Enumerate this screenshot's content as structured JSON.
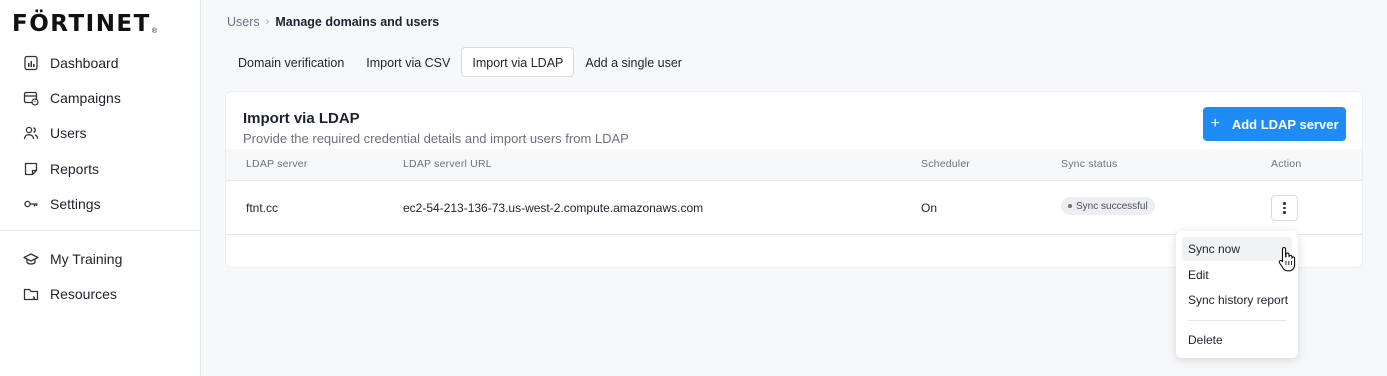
{
  "logo": {
    "text": "FÖRTINET",
    "reg": "®"
  },
  "sidebar": {
    "items": [
      {
        "label": "Dashboard",
        "icon": "dashboard-icon"
      },
      {
        "label": "Campaigns",
        "icon": "campaigns-icon"
      },
      {
        "label": "Users",
        "icon": "users-icon"
      },
      {
        "label": "Reports",
        "icon": "reports-icon"
      },
      {
        "label": "Settings",
        "icon": "settings-key-icon"
      }
    ],
    "bottom_items": [
      {
        "label": "My Training",
        "icon": "graduation-cap-icon"
      },
      {
        "label": "Resources",
        "icon": "folder-icon"
      }
    ]
  },
  "breadcrumb": {
    "parent": "Users",
    "separator": "›",
    "current": "Manage domains and users"
  },
  "tabs": [
    {
      "label": "Domain verification",
      "active": false
    },
    {
      "label": "Import via CSV",
      "active": false
    },
    {
      "label": "Import via LDAP",
      "active": true
    },
    {
      "label": "Add a single user",
      "active": false
    }
  ],
  "card": {
    "title": "Import via LDAP",
    "subtitle": "Provide the required credential details and import users from LDAP",
    "add_button": {
      "icon": "+",
      "label": "Add LDAP server"
    }
  },
  "table": {
    "headers": [
      "LDAP server",
      "LDAP serverl URL",
      "Scheduler",
      "Sync status",
      "Action"
    ],
    "rows": [
      {
        "server": "ftnt.cc",
        "url": "ec2-54-213-136-73.us-west-2.compute.amazonaws.com",
        "scheduler": "On",
        "status": "Sync successful"
      }
    ]
  },
  "action_menu": {
    "items": [
      "Sync now",
      "Edit",
      "Sync history report"
    ],
    "danger_item": "Delete"
  },
  "colors": {
    "accent": "#1f8bf5",
    "sidebar_bg": "#ffffff",
    "page_bg": "#f7f8fa"
  }
}
